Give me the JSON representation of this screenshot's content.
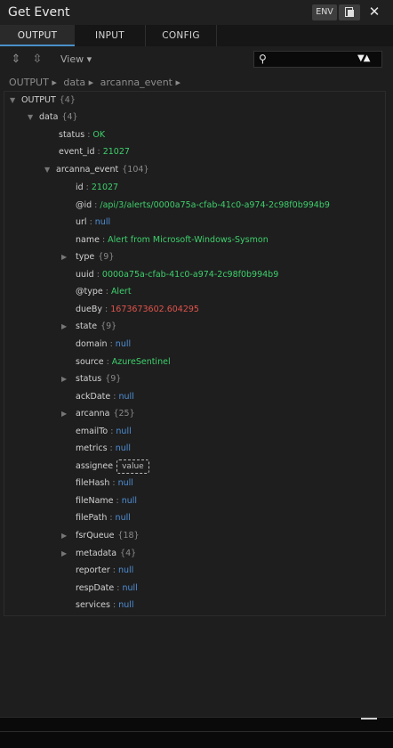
{
  "window": {
    "title": "Get Event",
    "env_label": "ENV",
    "close_glyph": "✕"
  },
  "tabs": [
    {
      "label": "OUTPUT",
      "active": true
    },
    {
      "label": "INPUT",
      "active": false
    },
    {
      "label": "CONFIG",
      "active": false
    }
  ],
  "toolbar": {
    "expand_icon": "⇕",
    "collapse_icon": "⇳",
    "view_label": "View ▾",
    "search_icon_glyph": "⚲",
    "search_value": "",
    "search_arrows": "▼▲"
  },
  "breadcrumb": [
    "OUTPUT ▸",
    "data ▸",
    "arcanna_event ▸"
  ],
  "tree": {
    "output": {
      "key": "OUTPUT",
      "count": "{4}"
    },
    "data": {
      "key": "data",
      "count": "{4}"
    },
    "status": {
      "key": "status",
      "value": "OK"
    },
    "event_id": {
      "key": "event_id",
      "value": "21027"
    },
    "arcanna_event": {
      "key": "arcanna_event",
      "count": "{104}"
    },
    "fields": [
      {
        "key": "id",
        "value": "21027",
        "color": "green"
      },
      {
        "key": "@id",
        "value": "/api/3/alerts/0000a75a-cfab-41c0-a974-2c98f0b994b9",
        "color": "green"
      },
      {
        "key": "url",
        "value": "null",
        "color": "blue"
      },
      {
        "key": "name",
        "value": "Alert from Microsoft-Windows-Sysmon",
        "color": "green"
      },
      {
        "key": "type",
        "count": "{9}",
        "collapsible": true
      },
      {
        "key": "uuid",
        "value": "0000a75a-cfab-41c0-a974-2c98f0b994b9",
        "color": "green"
      },
      {
        "key": "@type",
        "value": "Alert",
        "color": "green"
      },
      {
        "key": "dueBy",
        "value": "1673673602.604295",
        "color": "red"
      },
      {
        "key": "state",
        "count": "{9}",
        "collapsible": true
      },
      {
        "key": "domain",
        "value": "null",
        "color": "blue"
      },
      {
        "key": "source",
        "value": "AzureSentinel",
        "color": "green"
      },
      {
        "key": "status",
        "count": "{9}",
        "collapsible": true
      },
      {
        "key": "ackDate",
        "value": "null",
        "color": "blue"
      },
      {
        "key": "arcanna",
        "count": "{25}",
        "collapsible": true
      },
      {
        "key": "emailTo",
        "value": "null",
        "color": "blue"
      },
      {
        "key": "metrics",
        "value": "null",
        "color": "blue"
      },
      {
        "key": "assignee",
        "value_box": "value"
      },
      {
        "key": "fileHash",
        "value": "null",
        "color": "blue"
      },
      {
        "key": "fileName",
        "value": "null",
        "color": "blue"
      },
      {
        "key": "filePath",
        "value": "null",
        "color": "blue"
      },
      {
        "key": "fsrQueue",
        "count": "{18}",
        "collapsible": true
      },
      {
        "key": "metadata",
        "count": "{4}",
        "collapsible": true
      },
      {
        "key": "reporter",
        "value": "null",
        "color": "blue"
      },
      {
        "key": "respDate",
        "value": "null",
        "color": "blue"
      },
      {
        "key": "services",
        "value": "null",
        "color": "blue"
      }
    ]
  },
  "colors": {
    "green": "#3ecf6c",
    "blue": "#4f8fd6",
    "red": "#e0534b",
    "accent": "#4a90c8"
  }
}
